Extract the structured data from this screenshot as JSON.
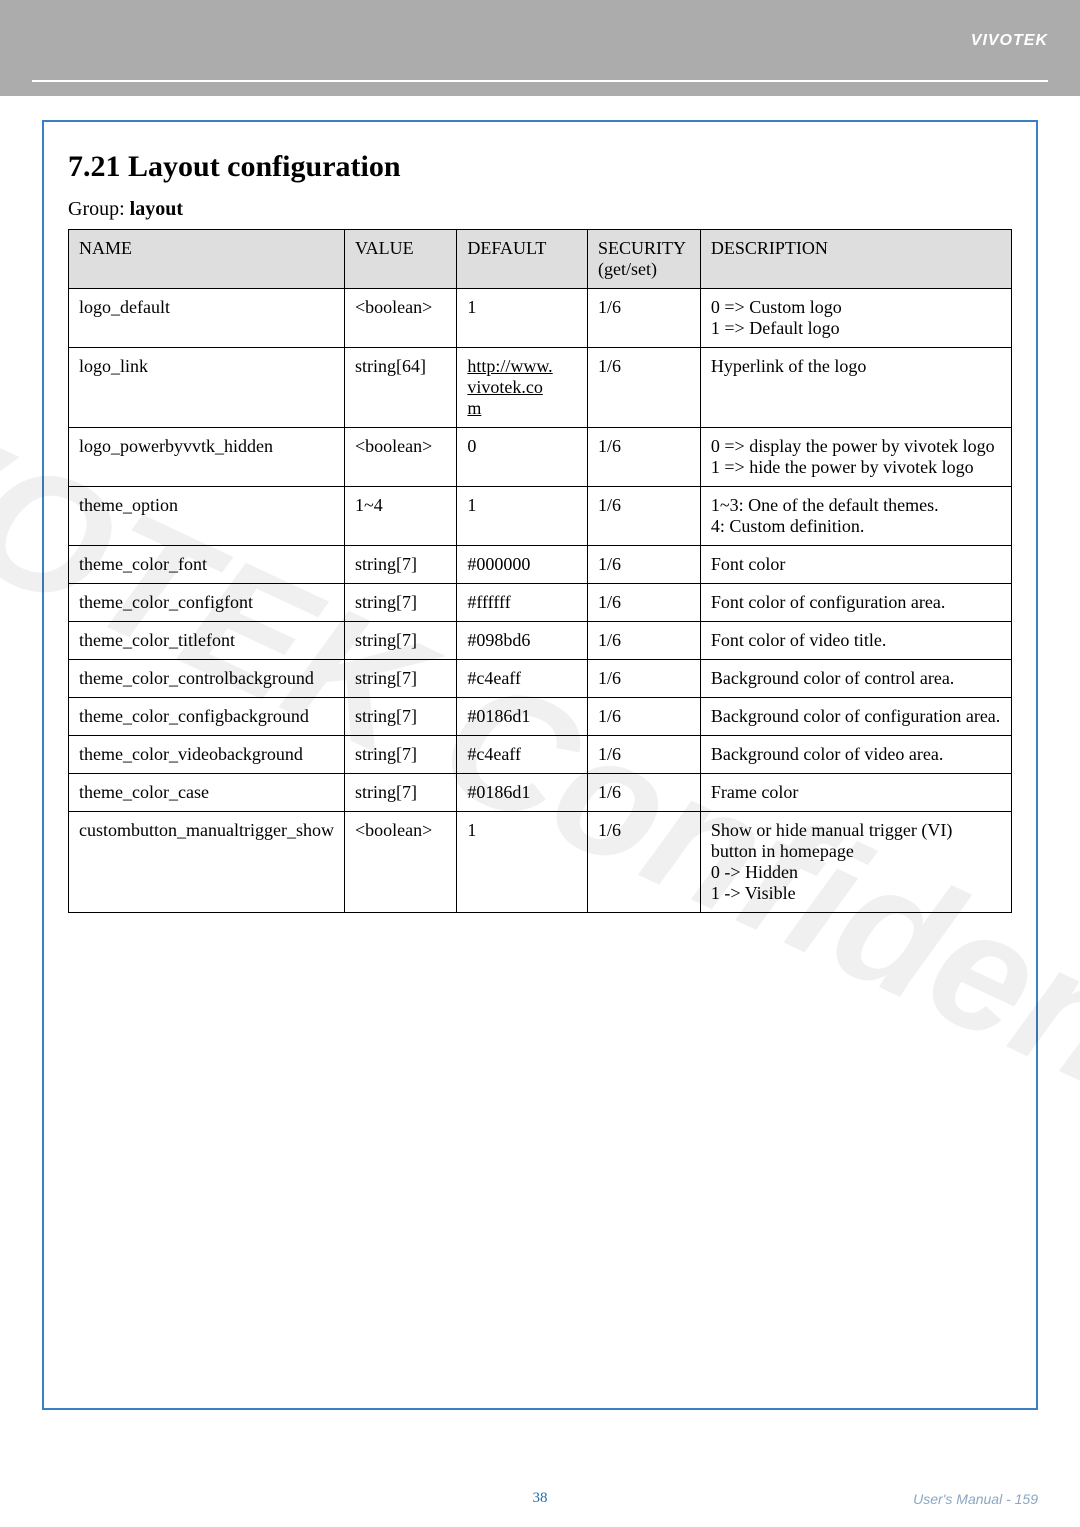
{
  "brand": "VIVOTEK",
  "watermark": "VIVOTEK Confidential",
  "heading": "7.21 Layout configuration",
  "group_label": "Group: ",
  "group_name": "layout",
  "columns": {
    "name": "NAME",
    "value": "VALUE",
    "default": "DEFAULT",
    "security": "SECURITY (get/set)",
    "description": "DESCRIPTION"
  },
  "rows": [
    {
      "name": "logo_default",
      "value": "<boolean>",
      "default": "1",
      "security": "1/6",
      "description": "0 => Custom logo\n1 => Default logo"
    },
    {
      "name": "logo_link",
      "value": "string[64]",
      "default_link": "http://www.vivotek.com",
      "security": "1/6",
      "description": "Hyperlink of the logo"
    },
    {
      "name": "logo_powerbyvvtk_hidden",
      "value": "<boolean>",
      "default": "0",
      "security": "1/6",
      "description": "0 => display the power by vivotek logo\n1 => hide the power by vivotek logo"
    },
    {
      "name": "theme_option",
      "value": "1~4",
      "default": "1",
      "security": "1/6",
      "description": "1~3: One of the default themes.\n4: Custom definition."
    },
    {
      "name": "theme_color_font",
      "value": "string[7]",
      "default": "#000000",
      "security": "1/6",
      "description": "Font color"
    },
    {
      "name": "theme_color_configfont",
      "value": "string[7]",
      "default": "#ffffff",
      "security": "1/6",
      "description": "Font color of configuration area."
    },
    {
      "name": "theme_color_titlefont",
      "value": "string[7]",
      "default": "#098bd6",
      "security": "1/6",
      "description": "Font color of video title."
    },
    {
      "name": "theme_color_controlbackground",
      "value": "string[7]",
      "default": "#c4eaff",
      "security": "1/6",
      "description": "Background color of control area."
    },
    {
      "name": "theme_color_configbackground",
      "value": "string[7]",
      "default": "#0186d1",
      "security": "1/6",
      "description": "Background color of configuration area."
    },
    {
      "name": "theme_color_videobackground",
      "value": "string[7]",
      "default": "#c4eaff",
      "security": "1/6",
      "description": "Background color of video area."
    },
    {
      "name": "theme_color_case",
      "value": "string[7]",
      "default": "#0186d1",
      "security": "1/6",
      "description": "Frame color"
    },
    {
      "name": "custombutton_manualtrigger_show",
      "value": "<boolean>",
      "default": "1",
      "security": "1/6",
      "description": "Show or hide manual trigger (VI) button in homepage\n0 -> Hidden\n1 -> Visible"
    }
  ],
  "footer": {
    "page_inner": "38",
    "manual": "User's Manual - 159"
  }
}
